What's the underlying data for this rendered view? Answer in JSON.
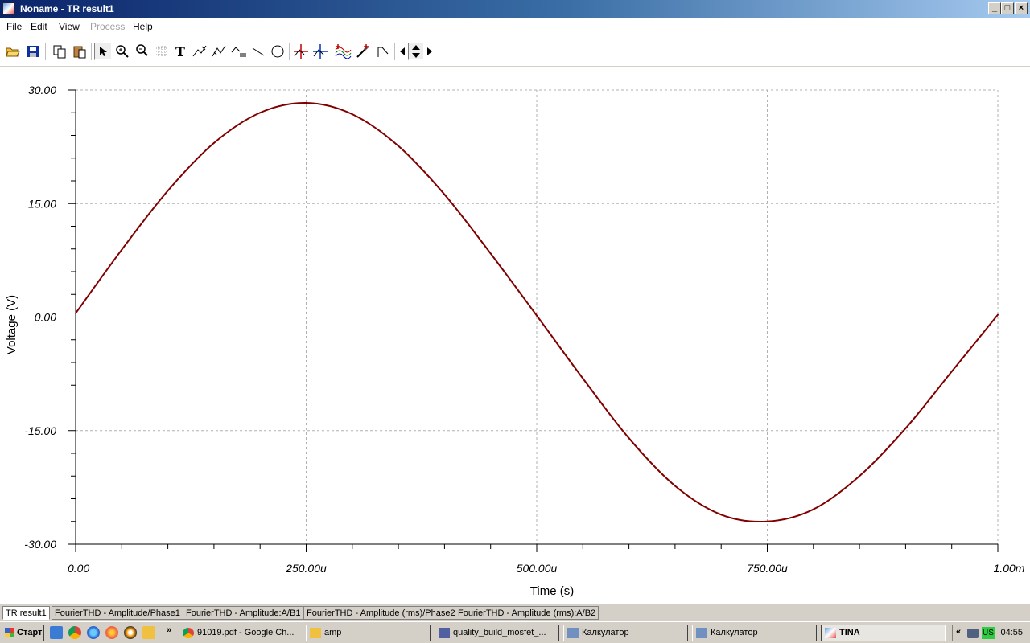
{
  "window": {
    "title": "Noname - TR result1",
    "buttons": [
      "_",
      "□",
      "×"
    ]
  },
  "menu": {
    "items": [
      "File",
      "Edit",
      "View",
      "Process",
      "Help"
    ],
    "disabled": [
      "Process"
    ]
  },
  "toolbar": {
    "icons": [
      "open-icon",
      "save-icon",
      "copy-icon",
      "paste-icon",
      "pointer-icon",
      "zoom-in-icon",
      "zoom-100-icon",
      "grid-icon",
      "text-icon",
      "draw-curve-icon",
      "draw-curve2-icon",
      "draw-label-icon",
      "line-icon",
      "circle-icon",
      "cursor-a-icon",
      "cursor-b-icon",
      "add-curve-icon",
      "pick-icon",
      "slope-icon",
      "arrow-left-icon",
      "arrow-updown-icon",
      "arrow-right-icon"
    ],
    "text_tool_glyph": "T"
  },
  "chart_data": {
    "type": "line",
    "xlabel": "Time (s)",
    "ylabel": "Voltage (V)",
    "xlim": [
      0,
      0.001
    ],
    "ylim": [
      -30,
      30
    ],
    "x_ticks": [
      0,
      0.00025,
      0.0005,
      0.00075,
      0.001
    ],
    "x_tick_labels": [
      "0.00",
      "250.00u",
      "500.00u",
      "750.00u",
      "1.00m"
    ],
    "y_ticks": [
      30,
      15,
      0,
      -15,
      -30
    ],
    "y_tick_labels": [
      "30.00",
      "15.00",
      "0.00",
      "-15.00",
      "-30.00"
    ],
    "grid": true,
    "line_color": "#800000",
    "series": [
      {
        "x": [
          0,
          5e-05,
          0.0001,
          0.00015,
          0.0002,
          0.00025,
          0.0003,
          0.00035,
          0.0004,
          0.00045,
          0.0005,
          0.00055,
          0.0006,
          0.00065,
          0.0007,
          0.00075,
          0.0008,
          0.00085,
          0.0009,
          0.00095,
          0.001
        ],
        "values": [
          0.5,
          8.9,
          16.7,
          23.0,
          27.0,
          28.3,
          26.8,
          22.6,
          16.2,
          8.4,
          0.2,
          -8.1,
          -16.0,
          -22.3,
          -26.1,
          -27.0,
          -25.4,
          -21.0,
          -14.7,
          -7.2,
          0.3
        ]
      }
    ]
  },
  "tabs": [
    {
      "label": "TR result1",
      "active": true
    },
    {
      "label": "FourierTHD - Amplitude/Phase1",
      "active": false
    },
    {
      "label": "FourierTHD - Amplitude:A/B1",
      "active": false
    },
    {
      "label": "FourierTHD - Amplitude (rms)/Phase2",
      "active": false
    },
    {
      "label": "FourierTHD - Amplitude (rms):A/B2",
      "active": false
    }
  ],
  "taskbar": {
    "start_label": "Старт",
    "more_label": "»",
    "buttons": [
      {
        "label": "91019.pdf - Google Ch...",
        "icon": "chrome-icon"
      },
      {
        "label": "amp",
        "icon": "folder-icon"
      },
      {
        "label": "quality_build_mosfet_...",
        "icon": "document-icon"
      },
      {
        "label": "Калкулатор",
        "icon": "calculator-icon"
      },
      {
        "label": "Калкулатор",
        "icon": "calculator-icon"
      },
      {
        "label": "TINA",
        "icon": "tina-icon"
      }
    ],
    "tray_collapse": "«",
    "lang": "US",
    "clock": "04:55"
  }
}
